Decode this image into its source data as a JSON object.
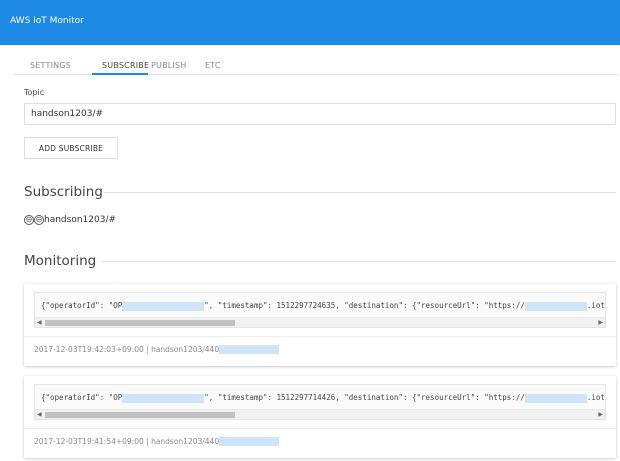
{
  "app": {
    "title": "AWS IoT Monitor"
  },
  "tabs": [
    {
      "label": "SETTINGS"
    },
    {
      "label": "SUBSCRIBE"
    },
    {
      "label": "PUBLISH"
    },
    {
      "label": "ETC"
    }
  ],
  "subscribe_form": {
    "topic_label": "Topic",
    "topic_value": "handson1203/#",
    "add_button": "ADD SUBSCRIBE"
  },
  "subscribing": {
    "title": "Subscribing",
    "items": [
      {
        "topic": "handson1203/#"
      }
    ]
  },
  "monitoring": {
    "title": "Monitoring",
    "messages": [
      {
        "payload_start": "{\"operatorId\": \"OP",
        "payload_mid": "\", \"timestamp\": 1512297724635, \"destination\": {\"resourceUrl\": \"https://",
        "payload_end": ".iot.us-west-",
        "timestamp": "2017-12-03T19:42:03+09:00",
        "separator": "|",
        "topic_prefix": "handson1203/440"
      },
      {
        "payload_start": "{\"operatorId\": \"OP",
        "payload_mid": "\", \"timestamp\": 1512297714426, \"destination\": {\"resourceUrl\": \"https://",
        "payload_end": ".iot.us-west-",
        "timestamp": "2017-12-03T19:41:54+09:00",
        "separator": "|",
        "topic_prefix": "handson1203/440"
      }
    ]
  },
  "icons": {
    "remove": "⊖",
    "scroll_left": "◀",
    "scroll_right": "▶"
  },
  "colors": {
    "appbar": "#1e88e5",
    "tab_indicator": "#1e88e5",
    "redaction": "#d0e4f7"
  }
}
